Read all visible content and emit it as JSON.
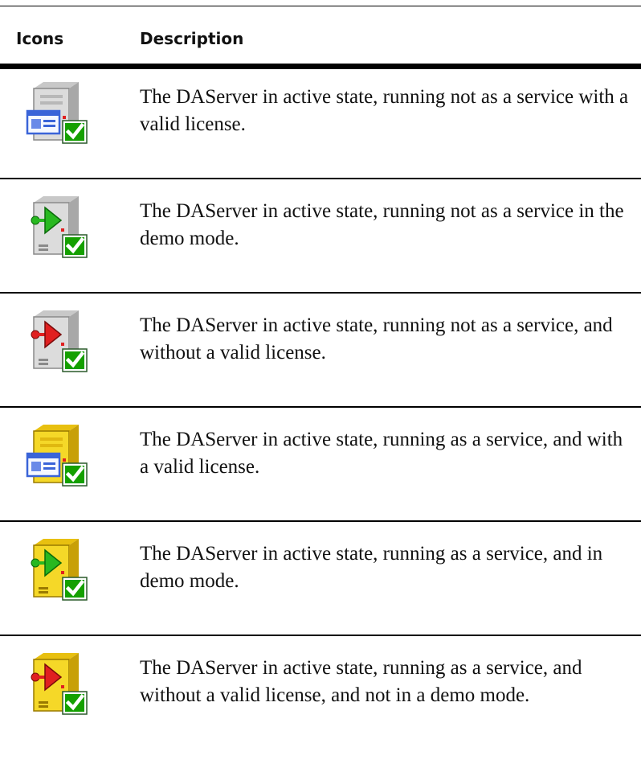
{
  "table": {
    "headers": {
      "icons": "Icons",
      "description": "Description"
    },
    "rows": [
      {
        "icon": "server-valid-license-icon",
        "description": "The DAServer in active state, running not as a service with a valid license."
      },
      {
        "icon": "server-demo-mode-icon",
        "description": "The DAServer in active state, running not as a service in the demo mode."
      },
      {
        "icon": "server-no-license-icon",
        "description": "The DAServer in active state, running not as a service, and without a valid license."
      },
      {
        "icon": "service-valid-license-icon",
        "description": "The DAServer in active state, running as a service, and with a valid license."
      },
      {
        "icon": "service-demo-mode-icon",
        "description": "The DAServer in active state, running as a service, and in demo mode."
      },
      {
        "icon": "service-no-license-icon",
        "description": "The DAServer in active state, running as a service, and without a valid license, and not in a demo mode."
      }
    ]
  },
  "colors": {
    "server_body": "#d8d8d8",
    "service_body": "#f0d020",
    "check_green": "#14a000",
    "play_green": "#28b820",
    "play_red": "#e02020",
    "card_blue": "#3a64d8"
  }
}
